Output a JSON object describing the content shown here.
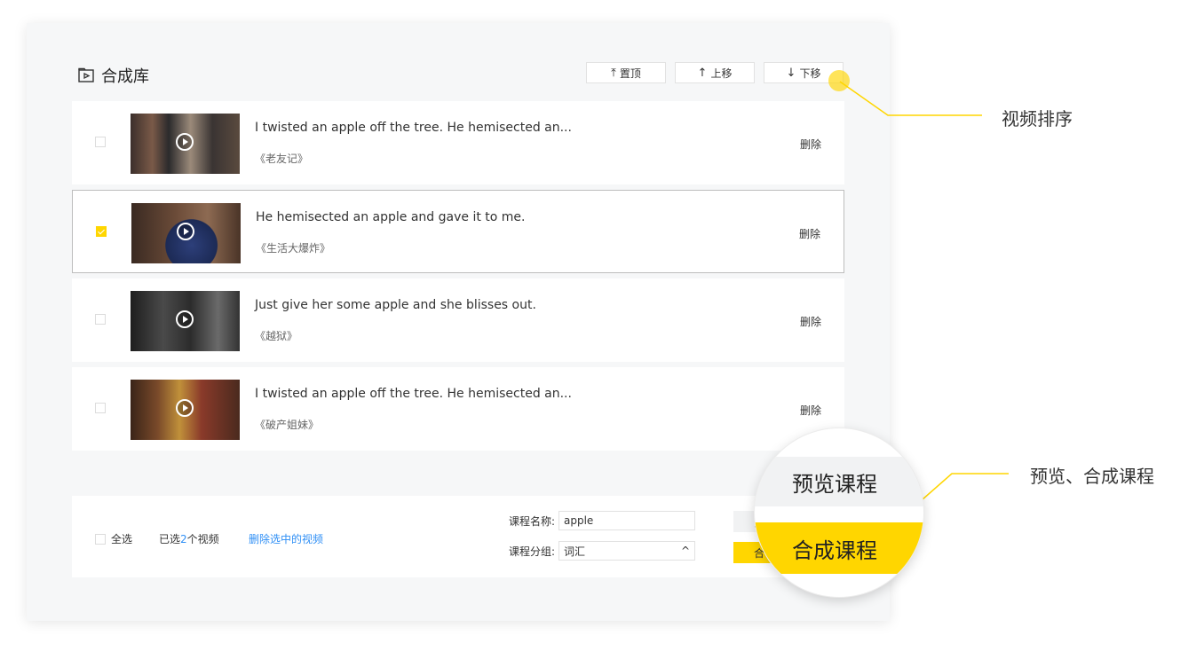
{
  "header": {
    "title": "合成库"
  },
  "toolbar": [
    {
      "label": "置顶",
      "arrow": "⤒"
    },
    {
      "label": "上移",
      "arrow": "↑"
    },
    {
      "label": "下移",
      "arrow": "↓"
    }
  ],
  "rows": [
    {
      "sentence": "I twisted an apple off the tree. He hemisected an...",
      "source": "《老友记》",
      "delete": "删除",
      "checked": false
    },
    {
      "sentence": "He hemisected an apple and gave it to me.",
      "source": "《生活大爆炸》",
      "delete": "删除",
      "checked": true
    },
    {
      "sentence": "Just give her some apple and she blisses out.",
      "source": "《越狱》",
      "delete": "删除",
      "checked": false
    },
    {
      "sentence": "I twisted an apple off the tree. He hemisected an...",
      "source": "《破产姐妹》",
      "delete": "删除",
      "checked": false
    }
  ],
  "footer": {
    "select_all": "全选",
    "selected_prefix": "已选",
    "selected_count": "2",
    "selected_suffix": "个视频",
    "delete_selected": "删除选中的视频",
    "course_name_label": "课程名称:",
    "course_name_value": "apple",
    "course_group_label": "课程分组:",
    "course_group_value": "词汇",
    "preview_btn_partial": "预",
    "compose_btn_partial": "合"
  },
  "zoom": {
    "preview": "预览课程",
    "compose": "合成课程"
  },
  "annotations": {
    "sort": "视频排序",
    "preview_compose": "预览、合成课程"
  },
  "colors": {
    "accent": "#ffd600",
    "link": "#2f8ff5",
    "panel_bg": "#f6f7f8"
  }
}
